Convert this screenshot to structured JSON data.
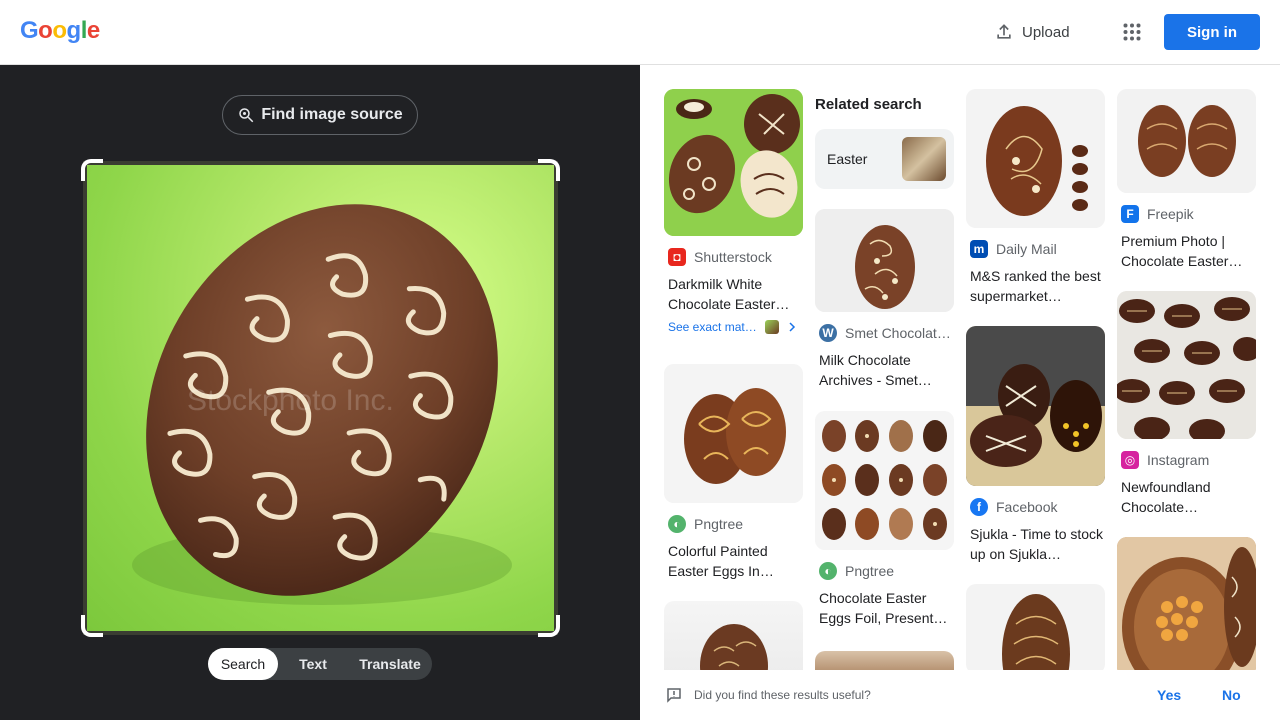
{
  "header": {
    "logo_letters": [
      "G",
      "o",
      "o",
      "g",
      "l",
      "e"
    ],
    "logo_colors": [
      "#4285f4",
      "#ea4335",
      "#fbbc05",
      "#4285f4",
      "#34a853",
      "#ea4335"
    ],
    "upload_label": "Upload",
    "signin_label": "Sign in"
  },
  "left": {
    "find_source_label": "Find image source",
    "tabs": [
      "Search",
      "Text",
      "Translate"
    ],
    "active_tab": "Search",
    "watermark": "Stockphoto Inc."
  },
  "related": {
    "heading": "Related search",
    "chip_label": "Easter"
  },
  "results": [
    {
      "source": "Shutterstock",
      "title": "Darkmilk White Chocolate Easter…",
      "icon_color": "#e8271e",
      "icon_letter": "S",
      "exact": "See exact mat…"
    },
    {
      "source": "Pngtree",
      "title": "Colorful Painted Easter Eggs In…",
      "icon_color": "#53b36c",
      "icon_letter": "P"
    },
    {
      "source": "Smet Chocolat…",
      "title": "Milk Chocolate Archives - Smet…",
      "icon_color": "#3c70a4",
      "icon_letter": "W"
    },
    {
      "source": "Pngtree",
      "title": "Chocolate Easter Eggs Foil, Present…",
      "icon_color": "#53b36c",
      "icon_letter": "P"
    },
    {
      "source": "Daily Mail",
      "title": "M&S ranked the best supermarket…",
      "icon_color": "#004db3",
      "icon_letter": "m"
    },
    {
      "source": "Facebook",
      "title": "Sjukla - Time to stock up on Sjukla…",
      "icon_color": "#1877f2",
      "icon_letter": "f"
    },
    {
      "source": "Freepik",
      "title": "Premium Photo | Chocolate Easter…",
      "icon_color": "#1273eb",
      "icon_letter": "F"
    },
    {
      "source": "Instagram",
      "title": "Newfoundland Chocolate…",
      "icon_color": "#d6249f",
      "icon_letter": "◎"
    }
  ],
  "feedback": {
    "question": "Did you find these results useful?",
    "yes": "Yes",
    "no": "No"
  }
}
